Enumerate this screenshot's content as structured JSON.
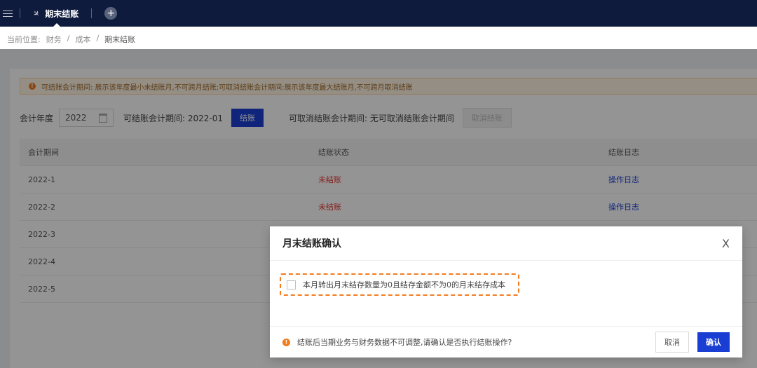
{
  "topbar": {
    "tab_label": "期末结账",
    "add_tab": "+"
  },
  "breadcrumb": {
    "prefix": "当前位置:",
    "items": [
      "财务",
      "/",
      "成本",
      "/"
    ],
    "current": "期末结账"
  },
  "alert": {
    "icon": "!",
    "text": "可结账会计期间: 展示该年度最小未结账月,不可跨月结账;可取消结账会计期间:展示该年度最大结账月,不可跨月取消结账"
  },
  "filters": {
    "year_label": "会计年度",
    "year_value": "2022",
    "closable_period": "可结账会计期间: 2022-01",
    "close_button": "结账",
    "cancel_period": "可取消结账会计期间: 无可取消结账会计期间",
    "cancel_button": "取消结账"
  },
  "table": {
    "headers": [
      "会计期间",
      "结账状态",
      "结账日志"
    ],
    "rows": [
      {
        "period": "2022-1",
        "status": "未结账",
        "log": "操作日志"
      },
      {
        "period": "2022-2",
        "status": "未结账",
        "log": "操作日志"
      },
      {
        "period": "2022-3",
        "status": "",
        "log": ""
      },
      {
        "period": "2022-4",
        "status": "",
        "log": ""
      },
      {
        "period": "2022-5",
        "status": "",
        "log": ""
      }
    ]
  },
  "modal": {
    "title": "月末结账确认",
    "close": "X",
    "checkbox_label": "本月转出月末结存数量为0且结存金额不为0的月末结存成本",
    "warn_icon": "!",
    "footer_text": "结账后当期业务与财务数据不可调整,请确认是否执行结账操作?",
    "cancel": "取消",
    "confirm": "确认"
  },
  "colors": {
    "topbar": "#0f1b3d",
    "primary": "#1a3ed3",
    "warning": "#f07c1c",
    "danger": "#e53935"
  }
}
